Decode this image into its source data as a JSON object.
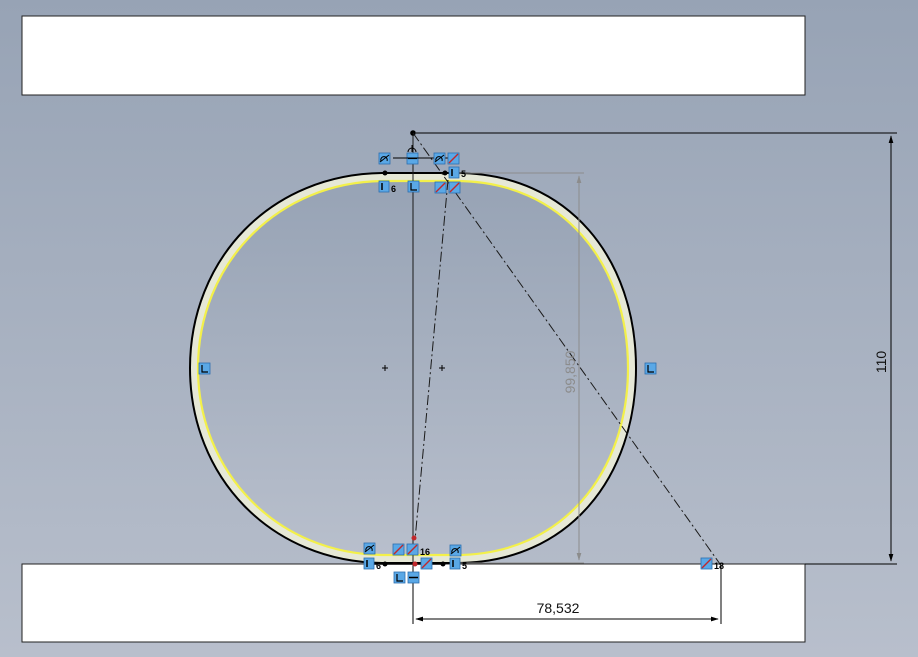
{
  "viewport": {
    "background_top": "#97a3b5",
    "background_bottom": "#b6bccb"
  },
  "sketch": {
    "profile_color": "#000000",
    "offset_color": "#f3f04a",
    "construction_color": "#1a1a1a",
    "body_fill": "#ffffff"
  },
  "dimensions": {
    "horizontal_value": "78,532",
    "vertical_outer_value": "110",
    "vertical_inner_value": "99,850"
  },
  "relation_tags": {
    "tag_6_top": "6",
    "tag_5_top": "5",
    "tag_16": "16",
    "tag_6_bottom": "6",
    "tag_5_bottom": "5",
    "tag_18": "18"
  }
}
